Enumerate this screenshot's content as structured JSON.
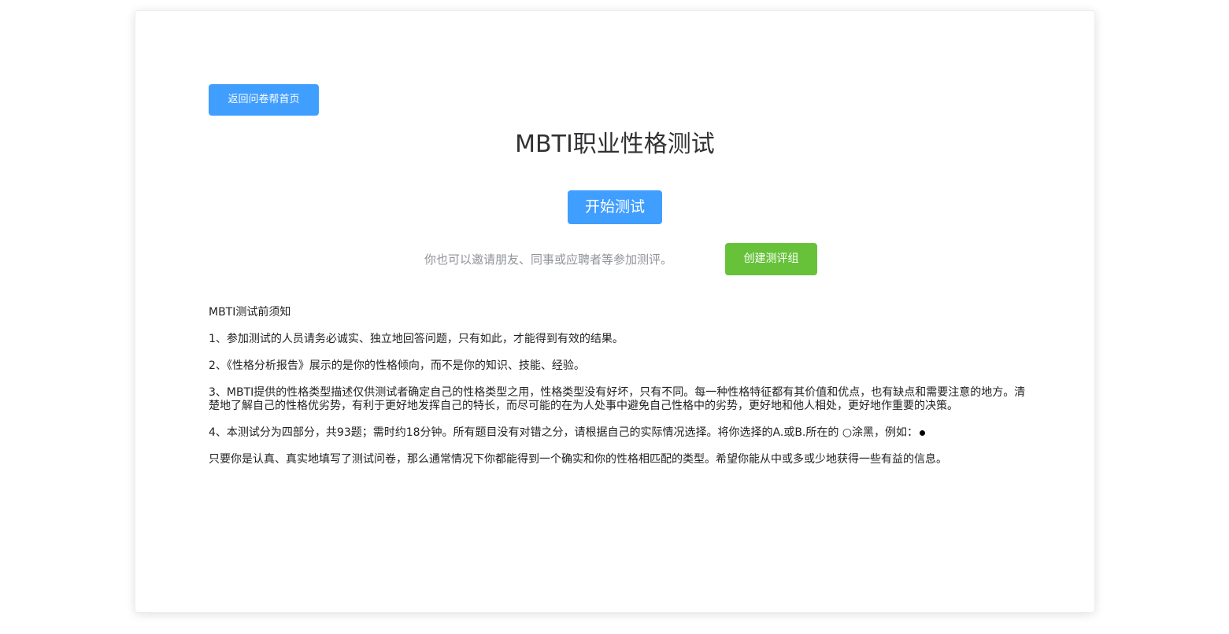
{
  "header": {
    "back_button_label": "返回问卷帮首页",
    "title": "MBTI职业性格测试"
  },
  "actions": {
    "start_button_label": "开始测试",
    "invite_text": "你也可以邀请朋友、同事或应聘者等参加测评。",
    "create_group_button_label": "创建测评组"
  },
  "notes": {
    "heading": "MBTI测试前须知",
    "items": [
      "1、参加测试的人员请务必诚实、独立地回答问题，只有如此，才能得到有效的结果。",
      "2、《性格分析报告》展示的是你的性格倾向，而不是你的知识、技能、经验。",
      "3、MBTI提供的性格类型描述仅供测试者确定自己的性格类型之用，性格类型没有好坏，只有不同。每一种性格特征都有其价值和优点，也有缺点和需要注意的地方。清楚地了解自己的性格优劣势，有利于更好地发挥自己的特长，而尽可能的在为人处事中避免自己性格中的劣势，更好地和他人相处，更好地作重要的决策。",
      "4、本测试分为四部分，共93题；需时约18分钟。所有题目没有对错之分，请根据自己的实际情况选择。将你选择的A.或B.所在的 ○涂黑，例如："
    ],
    "closing": "只要你是认真、真实地填写了测试问卷，那么通常情况下你都能得到一个确实和你的性格相匹配的类型。希望你能从中或多或少地获得一些有益的信息。"
  },
  "colors": {
    "primary": "#409eff",
    "success": "#67c23a",
    "muted_text": "#909399"
  }
}
